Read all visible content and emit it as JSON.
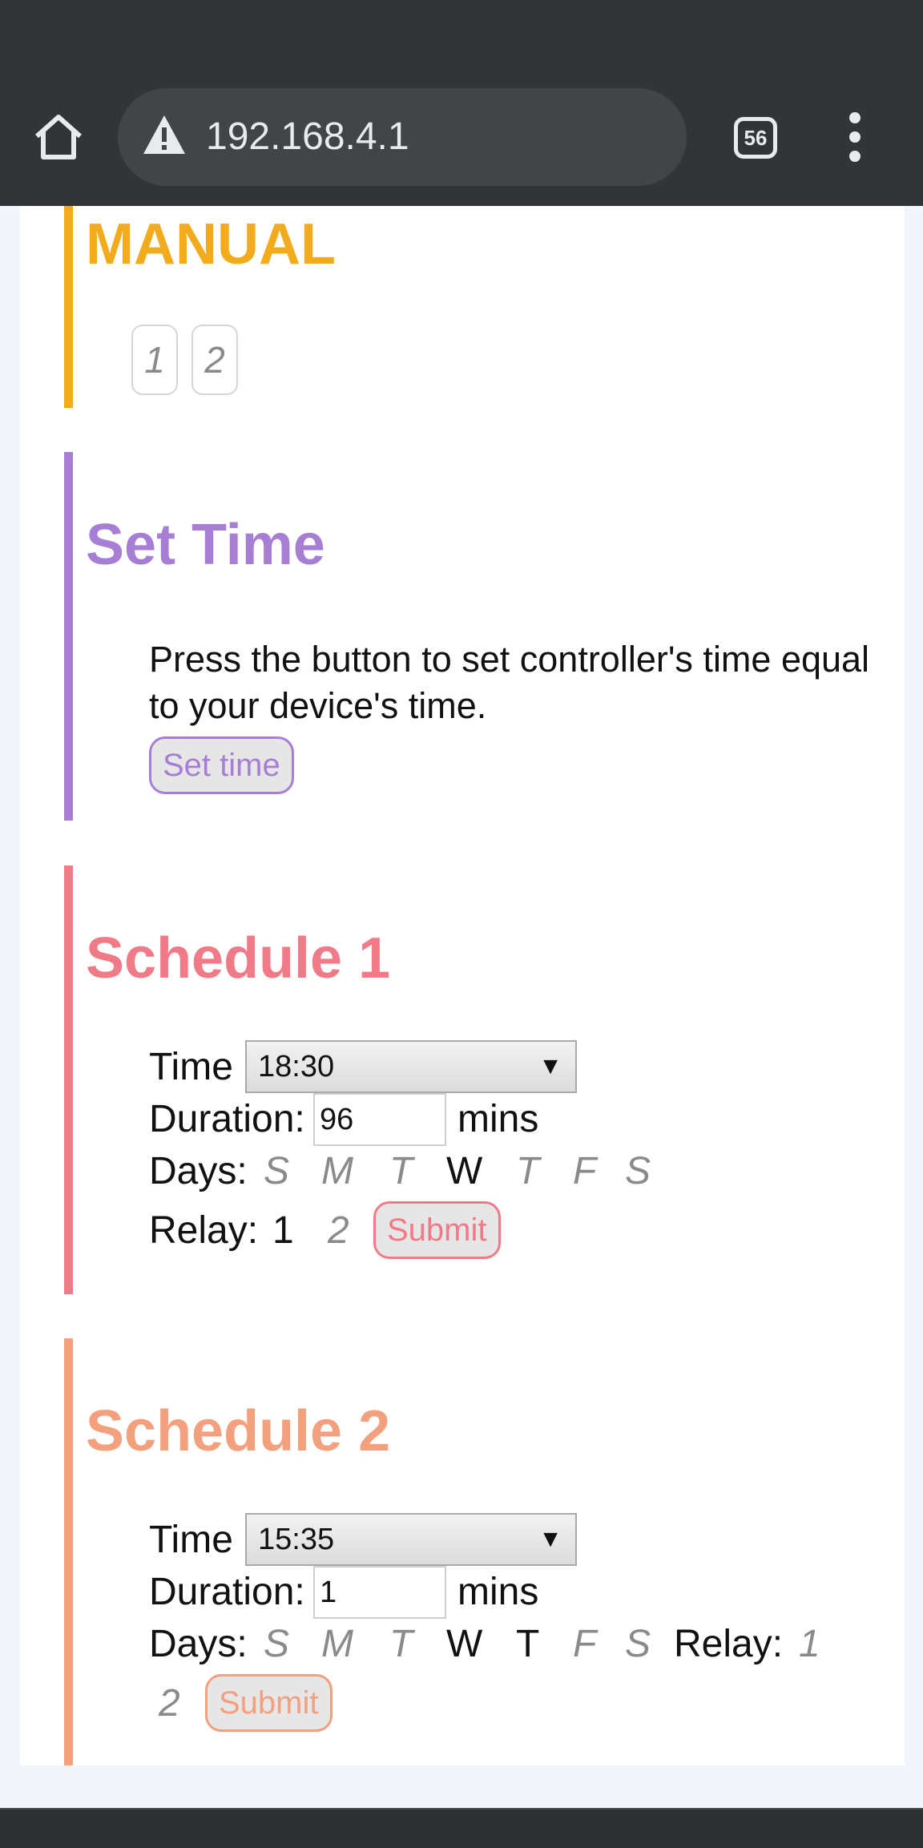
{
  "browser": {
    "url": "192.168.4.1",
    "tab_count": "56"
  },
  "manual": {
    "title": "MANUAL",
    "relays": [
      "1",
      "2"
    ]
  },
  "set_time": {
    "title": "Set Time",
    "description": "Press the button to set controller's time equal to your device's time.",
    "button_label": "Set time"
  },
  "schedule1": {
    "title": "Schedule 1",
    "time_label": "Time",
    "time_value": "18:30",
    "duration_label": "Duration:",
    "duration_value": "96",
    "duration_unit": "mins",
    "days_label": "Days:",
    "days": [
      {
        "letter": "S",
        "active": false
      },
      {
        "letter": "M",
        "active": false
      },
      {
        "letter": "T",
        "active": false
      },
      {
        "letter": "W",
        "active": true
      },
      {
        "letter": "T",
        "active": false
      },
      {
        "letter": "F",
        "active": false
      },
      {
        "letter": "S",
        "active": false
      }
    ],
    "relay_label": "Relay:",
    "relays": [
      {
        "label": "1",
        "active": true
      },
      {
        "label": "2",
        "active": false
      }
    ],
    "submit_label": "Submit"
  },
  "schedule2": {
    "title": "Schedule 2",
    "time_label": "Time",
    "time_value": "15:35",
    "duration_label": "Duration:",
    "duration_value": "1",
    "duration_unit": "mins",
    "days_label": "Days:",
    "days": [
      {
        "letter": "S",
        "active": false
      },
      {
        "letter": "M",
        "active": false
      },
      {
        "letter": "T",
        "active": false
      },
      {
        "letter": "W",
        "active": true
      },
      {
        "letter": "T",
        "active": true
      },
      {
        "letter": "F",
        "active": false
      },
      {
        "letter": "S",
        "active": false
      }
    ],
    "relay_label": "Relay:",
    "relays": [
      {
        "label": "1",
        "active": false
      },
      {
        "label": "2",
        "active": false
      }
    ],
    "submit_label": "Submit"
  },
  "colors": {
    "manual": "#f2ab1d",
    "set_time": "#a67fd4",
    "schedule1": "#f07a87",
    "schedule2": "#f3a07e"
  }
}
